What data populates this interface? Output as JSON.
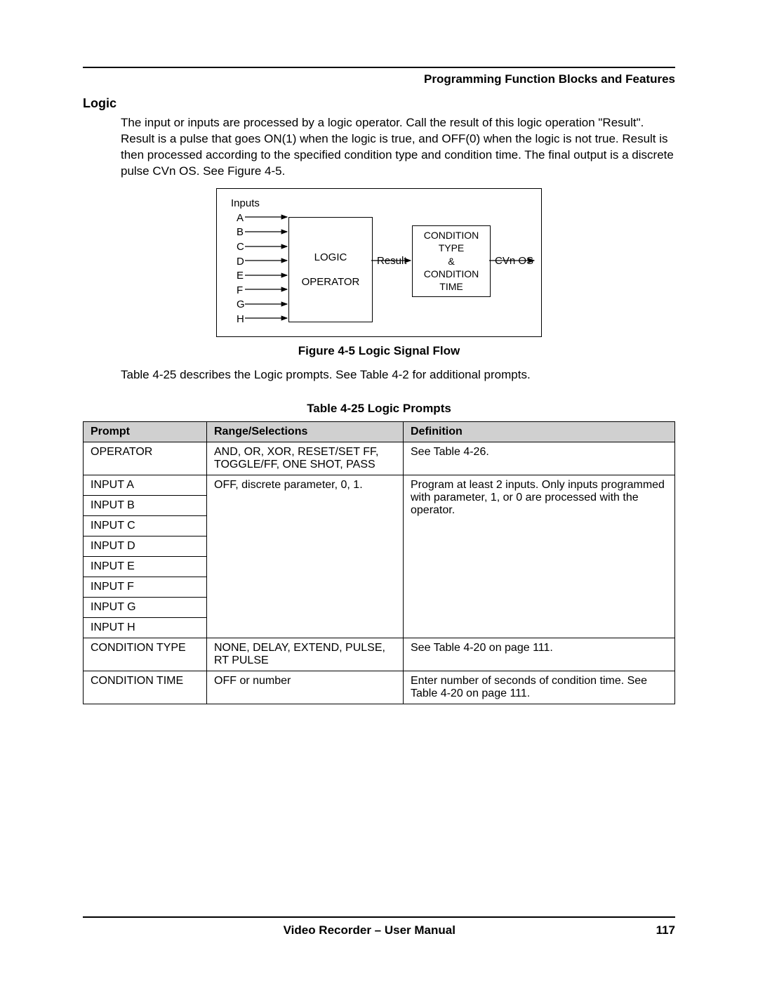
{
  "header": {
    "running": "Programming Function Blocks and Features"
  },
  "section": {
    "title": "Logic"
  },
  "para": {
    "main": "The input or inputs are processed by a logic operator.  Call the result of this logic operation \"Result\".  Result is a pulse that goes ON(1) when the logic is true, and OFF(0) when the logic is not true.  Result is then processed according to the specified condition type and condition time.  The final output is a discrete pulse CVn OS.  See Figure 4-5.",
    "desc": "Table 4-25 describes the Logic prompts. See Table 4-2 for additional prompts."
  },
  "figure": {
    "inputs_label": "Inputs",
    "inputs": [
      "A",
      "B",
      "C",
      "D",
      "E",
      "F",
      "G",
      "H"
    ],
    "logic_box": {
      "line1": "LOGIC",
      "line2": "OPERATOR"
    },
    "result": "Result",
    "cond_box": {
      "l1": "CONDITION",
      "l2": "TYPE",
      "l3": "&",
      "l4": "CONDITION",
      "l5": "TIME"
    },
    "cvn": "CVn OS",
    "caption": "Figure 4-5   Logic Signal Flow"
  },
  "table": {
    "caption": "Table 4-25   Logic Prompts",
    "headers": {
      "c1": "Prompt",
      "c2": "Range/Selections",
      "c3": "Definition"
    },
    "rows": {
      "r1": {
        "p": "OPERATOR",
        "r": "AND, OR, XOR, RESET/SET FF, TOGGLE/FF, ONE SHOT, PASS",
        "d": "See Table 4-26."
      },
      "r2": {
        "p": "INPUT A",
        "r": "OFF, discrete parameter, 0, 1.",
        "d": "Program at least 2 inputs.  Only inputs programmed with parameter, 1, or 0 are processed with the operator."
      },
      "r3": {
        "p": "INPUT B"
      },
      "r4": {
        "p": "INPUT C"
      },
      "r5": {
        "p": "INPUT D"
      },
      "r6": {
        "p": "INPUT E"
      },
      "r7": {
        "p": "INPUT F"
      },
      "r8": {
        "p": "INPUT G"
      },
      "r9": {
        "p": "INPUT H"
      },
      "r10": {
        "p": "CONDITION TYPE",
        "r": "NONE, DELAY, EXTEND, PULSE, RT PULSE",
        "d": "See Table 4-20 on page 111."
      },
      "r11": {
        "p": "CONDITION TIME",
        "r": "OFF or number",
        "d": "Enter number of seconds of condition time.  See Table 4-20 on page 111."
      }
    }
  },
  "footer": {
    "center": "Video Recorder – User Manual",
    "page": "117"
  }
}
